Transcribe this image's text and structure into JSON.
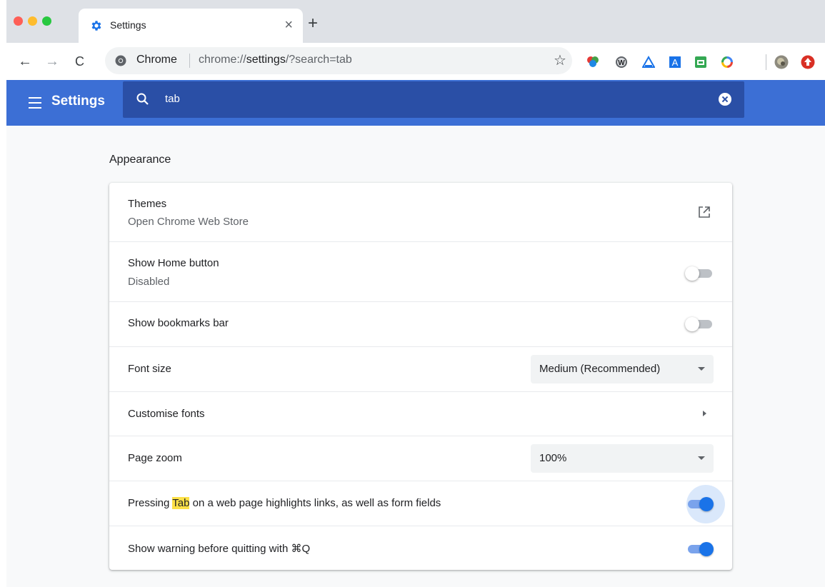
{
  "browser": {
    "tab": {
      "title": "Settings",
      "close_glyph": "×"
    },
    "new_tab_glyph": "+",
    "omnibox": {
      "site_label": "Chrome",
      "url_prefix": "chrome://",
      "url_bold": "settings",
      "url_suffix": "/?search=tab"
    },
    "nav": {
      "back": "←",
      "forward": "→",
      "reload": "C"
    },
    "bookmark_star": "☆",
    "extensions": [
      "color-extension-icon",
      "w-extension-icon",
      "drive-triangle-icon",
      "translate-a-icon",
      "green-printer-icon",
      "ring-color-icon",
      "avatar-icon",
      "red-up-arrow-icon"
    ]
  },
  "header": {
    "title": "Settings",
    "search": {
      "value": "tab"
    }
  },
  "appearance": {
    "section_title": "Appearance",
    "themes": {
      "label": "Themes",
      "sub": "Open Chrome Web Store"
    },
    "home_button": {
      "label": "Show Home button",
      "sub": "Disabled",
      "on": false
    },
    "bookmarks_bar": {
      "label": "Show bookmarks bar",
      "on": false
    },
    "font_size": {
      "label": "Font size",
      "value": "Medium (Recommended)"
    },
    "customise_fonts": {
      "label": "Customise fonts"
    },
    "page_zoom": {
      "label": "Page zoom",
      "value": "100%"
    },
    "tab_highlight": {
      "label_before": "Pressing ",
      "label_match": "Tab",
      "label_after": " on a web page highlights links, as well as form fields",
      "on": true
    },
    "quit_warning": {
      "label": "Show warning before quitting with ⌘Q",
      "on": true
    }
  },
  "colors": {
    "header_blue": "#3c6fd5",
    "search_blue": "#2a4fa6",
    "toggle_on": "#1a73e8",
    "highlight": "#fde047"
  }
}
